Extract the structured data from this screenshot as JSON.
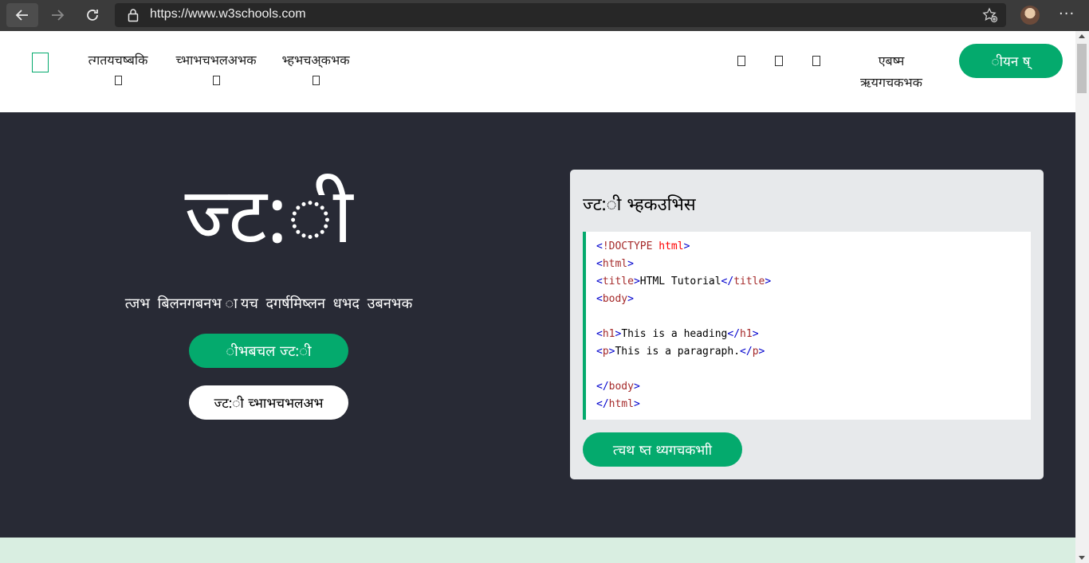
{
  "browser": {
    "url": "https://www.w3schools.com",
    "back_icon": "arrow-left-icon",
    "forward_icon": "arrow-right-icon",
    "reload_icon": "reload-icon",
    "menu_label": "···"
  },
  "topnav": {
    "items": [
      {
        "label": "त्गतयचष्बकि"
      },
      {
        "label": "च्भाभचभलअभक"
      },
      {
        "label": "भ्हभचअ्कभक"
      }
    ],
    "login_line1": "एबष्म",
    "login_line2": "ऋयगचकभक",
    "signup_label": "ीयन ष्"
  },
  "hero": {
    "title": "ज्ट:ी",
    "subtitle": "त्जभ बिलनगबनभ ायच दगर्षमिष्लन धभद उबनभक",
    "learn_button": "ीभबचल ज्ट:ी",
    "reference_button": "ज्ट:ी च्भाभचभलअभ"
  },
  "example": {
    "title": "ज्ट:ी भ्हकउभिस",
    "code": {
      "l1_open": "<",
      "l1_tag": "!DOCTYPE",
      "l1_attr": " html",
      "l1_close": ">",
      "l2_open": "<",
      "l2_tag": "html",
      "l2_close": ">",
      "l3_open": "<",
      "l3_tag": "title",
      "l3_close": ">",
      "l3_text": "HTML Tutorial",
      "l3_end_open": "</",
      "l3_end_tag": "title",
      "l3_end_close": ">",
      "l4_open": "<",
      "l4_tag": "body",
      "l4_close": ">",
      "l6_open": "<",
      "l6_tag": "h1",
      "l6_close": ">",
      "l6_text": "This is a heading",
      "l6_end_open": "</",
      "l6_end_tag": "h1",
      "l6_end_close": ">",
      "l7_open": "<",
      "l7_tag": "p",
      "l7_close": ">",
      "l7_text": "This is a paragraph.",
      "l7_end_open": "</",
      "l7_end_tag": "p",
      "l7_end_close": ">",
      "l9_open": "</",
      "l9_tag": "body",
      "l9_close": ">",
      "l10_open": "</",
      "l10_tag": "html",
      "l10_close": ">"
    },
    "try_button": "त्चथ ष्त थ्यगचकभाी"
  },
  "colors": {
    "accent": "#04aa6d",
    "hero_bg": "#282a35",
    "card_bg": "#e7e9eb",
    "next_section_bg": "#d9eee1"
  }
}
